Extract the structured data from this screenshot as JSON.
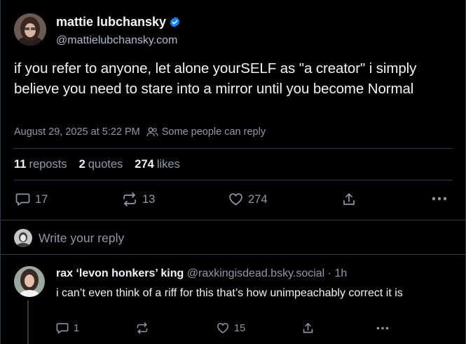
{
  "post": {
    "author": {
      "display_name": "mattie lubchansky",
      "handle": "@mattielubchansky.com",
      "verified": true
    },
    "text": "if you refer to anyone, let alone yourSELF as \"a creator\" i simply believe you need to stare into a mirror until you become Normal",
    "timestamp": "August 29, 2025 at 5:22 PM",
    "reply_setting": "Some people can reply",
    "stats": {
      "reposts_count": "11",
      "reposts_label": "reposts",
      "quotes_count": "2",
      "quotes_label": "quotes",
      "likes_count": "274",
      "likes_label": "likes"
    },
    "actions": {
      "reply_count": "17",
      "repost_count": "13",
      "like_count": "274"
    }
  },
  "reply_composer": {
    "placeholder": "Write your reply"
  },
  "reply": {
    "display_name": "rax ‘levon honkers’ king",
    "handle_and_time": "@raxkingisdead.bsky.social · 1h",
    "text": "i can’t even think of a riff for this that’s how unimpeachably correct it is",
    "actions": {
      "reply_count": "1",
      "like_count": "15"
    }
  },
  "colors": {
    "background": "#000000",
    "text": "#f1f3f5",
    "muted": "#8d9aa8",
    "divider": "#2e3a46",
    "verified": "#1083fe"
  }
}
